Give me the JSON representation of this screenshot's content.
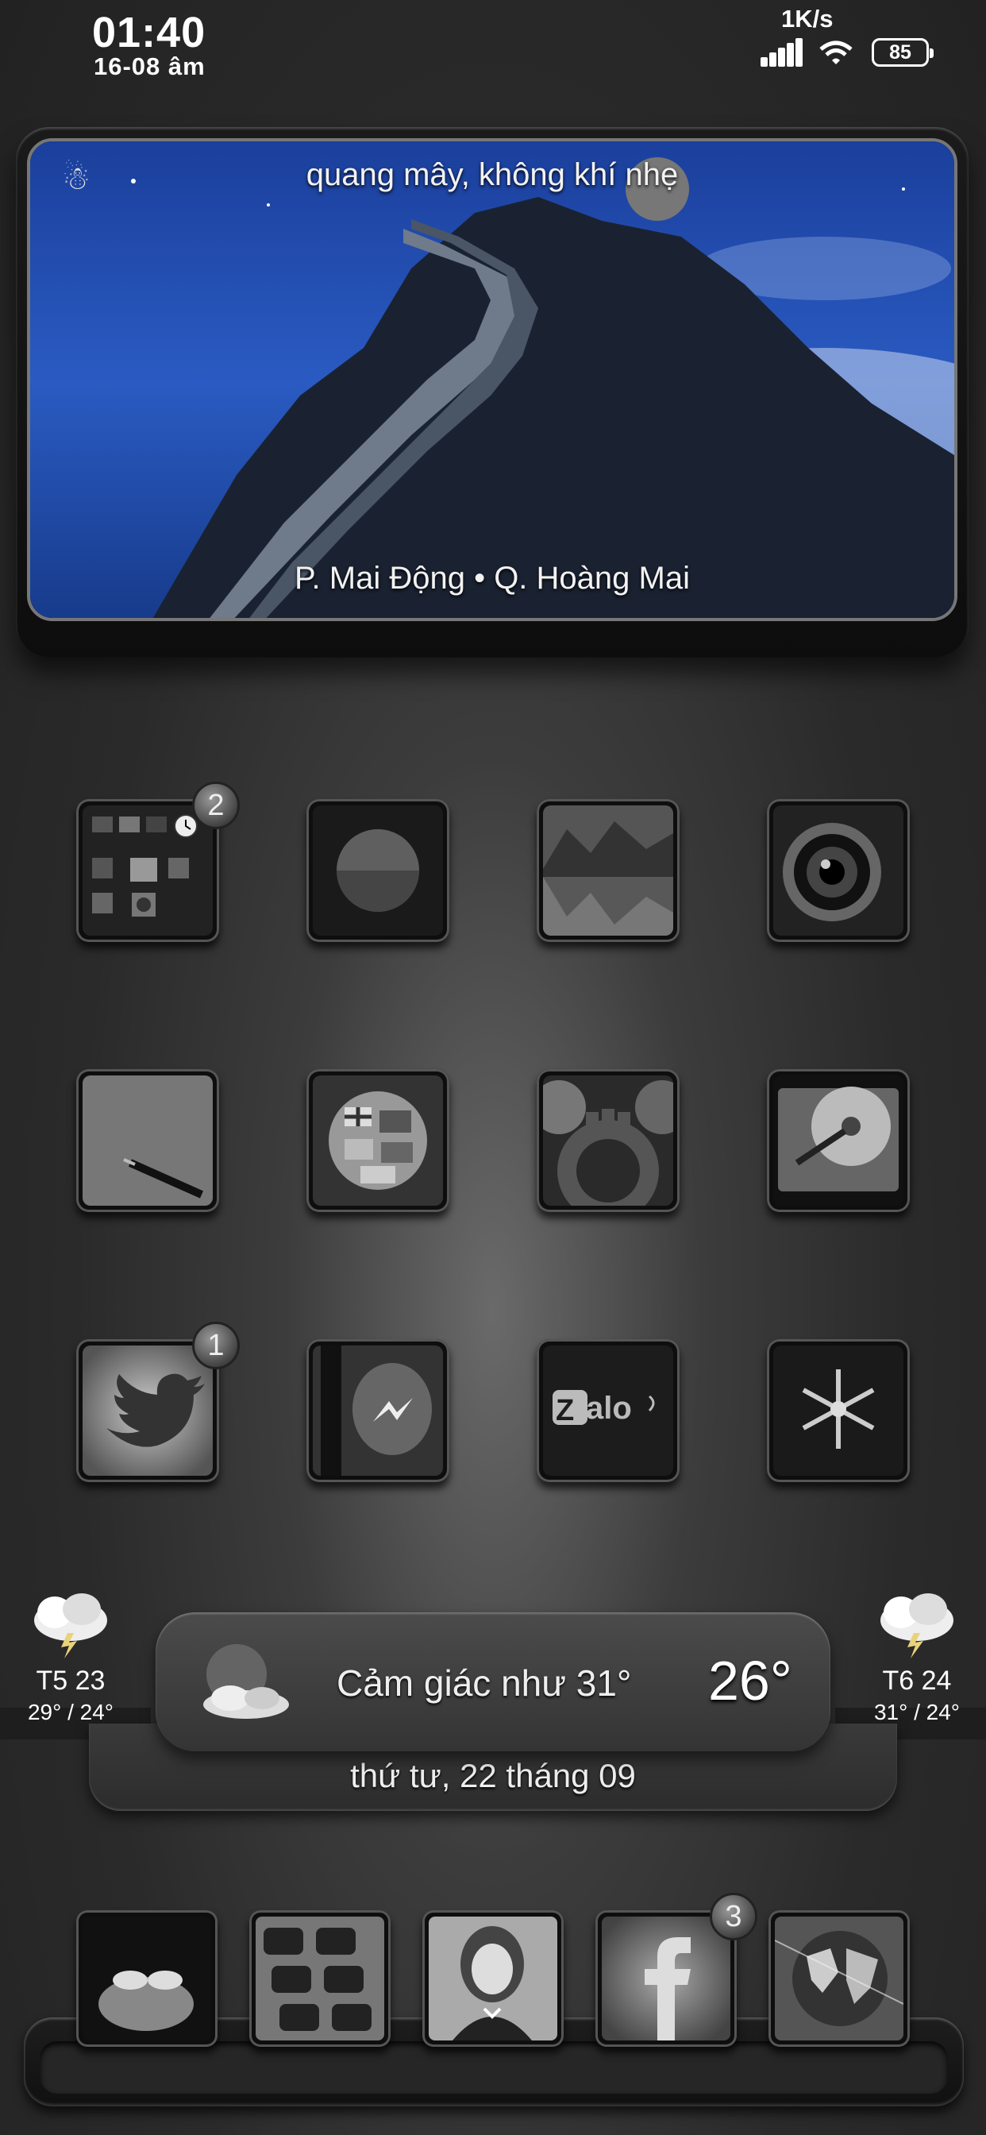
{
  "status_bar": {
    "time": "01:40",
    "date": "16-08 âm",
    "net_speed": "1K/s",
    "battery": "85"
  },
  "photo_widget": {
    "top_text": "quang mây, không khí nhẹ",
    "bottom_text": "P. Mai Động • Q. Hoàng Mai"
  },
  "apps": [
    {
      "name": "folder",
      "badge": "2"
    },
    {
      "name": "moon",
      "badge": ""
    },
    {
      "name": "lake",
      "badge": ""
    },
    {
      "name": "camera-lens",
      "badge": ""
    },
    {
      "name": "pen",
      "badge": ""
    },
    {
      "name": "globe-flags",
      "badge": ""
    },
    {
      "name": "gears",
      "badge": ""
    },
    {
      "name": "hard-drive",
      "badge": ""
    },
    {
      "name": "twitter",
      "badge": "1"
    },
    {
      "name": "messenger",
      "badge": ""
    },
    {
      "name": "zalo",
      "badge": ""
    },
    {
      "name": "snowflake",
      "badge": ""
    }
  ],
  "zalo_label": "Zalo",
  "weather": {
    "left": {
      "day": "T5 23",
      "range": "29° / 24°"
    },
    "right": {
      "day": "T6 24",
      "range": "31° / 24°"
    },
    "feels_like": "Cảm giác như 31°",
    "temperature": "26°",
    "date": "thứ tư, 22 tháng 09"
  },
  "dock": [
    {
      "name": "hands",
      "badge": ""
    },
    {
      "name": "keypad",
      "badge": ""
    },
    {
      "name": "portrait",
      "badge": ""
    },
    {
      "name": "facebook",
      "badge": "3"
    },
    {
      "name": "world-map",
      "badge": ""
    }
  ],
  "colors": {
    "background": "#2a2a2a",
    "accent": "#ffffff",
    "badge": "#6a6a6a"
  }
}
